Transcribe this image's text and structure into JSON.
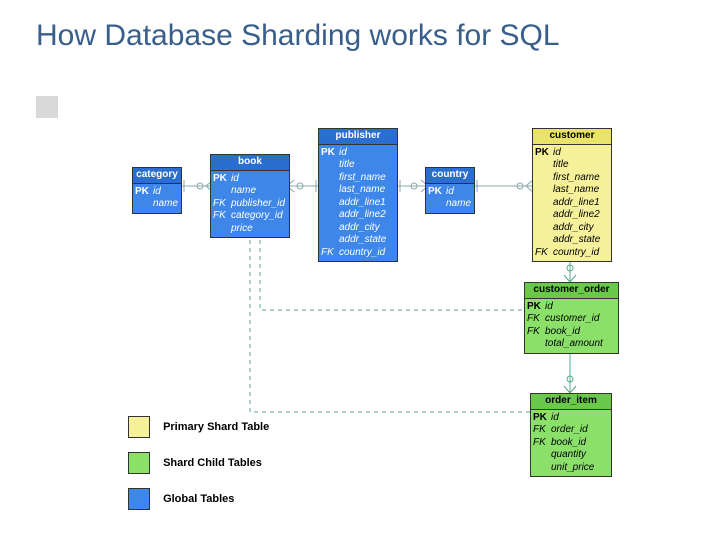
{
  "title": "How Database Sharding works for SQL",
  "entities": {
    "category": {
      "name": "category",
      "rows": [
        {
          "key": "PK",
          "name": "id"
        },
        {
          "key": "",
          "name": "name"
        }
      ]
    },
    "book": {
      "name": "book",
      "rows": [
        {
          "key": "PK",
          "name": "id"
        },
        {
          "key": "",
          "name": "name"
        },
        {
          "key": "FK",
          "name": "publisher_id"
        },
        {
          "key": "FK",
          "name": "category_id"
        },
        {
          "key": "",
          "name": "price"
        }
      ]
    },
    "publisher": {
      "name": "publisher",
      "rows": [
        {
          "key": "PK",
          "name": "id"
        },
        {
          "key": "",
          "name": "title"
        },
        {
          "key": "",
          "name": "first_name"
        },
        {
          "key": "",
          "name": "last_name"
        },
        {
          "key": "",
          "name": "addr_line1"
        },
        {
          "key": "",
          "name": "addr_line2"
        },
        {
          "key": "",
          "name": "addr_city"
        },
        {
          "key": "",
          "name": "addr_state"
        },
        {
          "key": "FK",
          "name": "country_id"
        }
      ]
    },
    "country": {
      "name": "country",
      "rows": [
        {
          "key": "PK",
          "name": "id"
        },
        {
          "key": "",
          "name": "name"
        }
      ]
    },
    "customer": {
      "name": "customer",
      "rows": [
        {
          "key": "PK",
          "name": "id"
        },
        {
          "key": "",
          "name": "title"
        },
        {
          "key": "",
          "name": "first_name"
        },
        {
          "key": "",
          "name": "last_name"
        },
        {
          "key": "",
          "name": "addr_line1"
        },
        {
          "key": "",
          "name": "addr_line2"
        },
        {
          "key": "",
          "name": "addr_city"
        },
        {
          "key": "",
          "name": "addr_state"
        },
        {
          "key": "FK",
          "name": "country_id"
        }
      ]
    },
    "customer_order": {
      "name": "customer_order",
      "rows": [
        {
          "key": "PK",
          "name": "id"
        },
        {
          "key": "FK",
          "name": "customer_id"
        },
        {
          "key": "FK",
          "name": "book_id"
        },
        {
          "key": "",
          "name": "total_amount"
        }
      ]
    },
    "order_item": {
      "name": "order_item",
      "rows": [
        {
          "key": "PK",
          "name": "id"
        },
        {
          "key": "FK",
          "name": "order_id"
        },
        {
          "key": "FK",
          "name": "book_id"
        },
        {
          "key": "",
          "name": "quantity"
        },
        {
          "key": "",
          "name": "unit_price"
        }
      ]
    }
  },
  "legend": {
    "primary": "Primary Shard Table",
    "child": "Shard Child Tables",
    "global": "Global Tables"
  },
  "colors": {
    "blue": "#3e87e8",
    "yellow": "#f5f19a",
    "green": "#8be06a"
  }
}
